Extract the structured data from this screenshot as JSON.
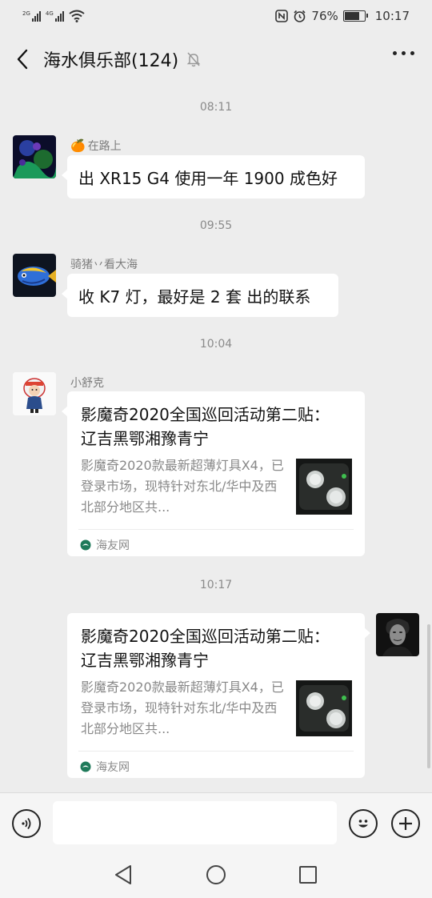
{
  "status_bar": {
    "net1": "2G",
    "net2": "4G",
    "battery": "76%",
    "battery_level": 0.76,
    "time": "10:17"
  },
  "header": {
    "title": "海水俱乐部(124)",
    "icons": [
      "back-arrow-icon",
      "mute-bell-icon",
      "more-icon"
    ]
  },
  "chat": {
    "timestamps": [
      "08:11",
      "09:55",
      "10:04",
      "10:17"
    ],
    "messages": [
      {
        "sender": "在路上",
        "sender_prefix": "🍊",
        "text": "出 XR15 G4 使用一年 1900 成色好"
      },
      {
        "sender": "骑猪丷看大海",
        "text": "收 K7 灯，最好是 2 套 出的联系"
      },
      {
        "sender": "小舒克",
        "card": {
          "title": "影魔奇2020全国巡回活动第二贴：  辽吉黑鄂湘豫青宁",
          "description": "影魔奇2020款最新超薄灯具X4，已登录市场，现特针对东北/华中及西北部分地区共...",
          "source": "海友网"
        }
      },
      {
        "sender": "",
        "self": true,
        "card": {
          "title": "影魔奇2020全国巡回活动第二贴：  辽吉黑鄂湘豫青宁",
          "description": "影魔奇2020款最新超薄灯具X4，已登录市场，现特针对东北/华中及西北部分地区共...",
          "source": "海友网"
        }
      }
    ]
  },
  "input_bar": {
    "value": "",
    "placeholder": "",
    "icons": [
      "voice-icon",
      "emoji-icon",
      "plus-icon"
    ]
  },
  "nav_bar": {
    "icons": [
      "back-triangle-icon",
      "home-circle-icon",
      "recents-square-icon"
    ]
  },
  "colors": {
    "background": "#ededed",
    "bubble": "#ffffff",
    "timestamp": "#8a8a8a",
    "source_icon": "#1f7a5a"
  }
}
